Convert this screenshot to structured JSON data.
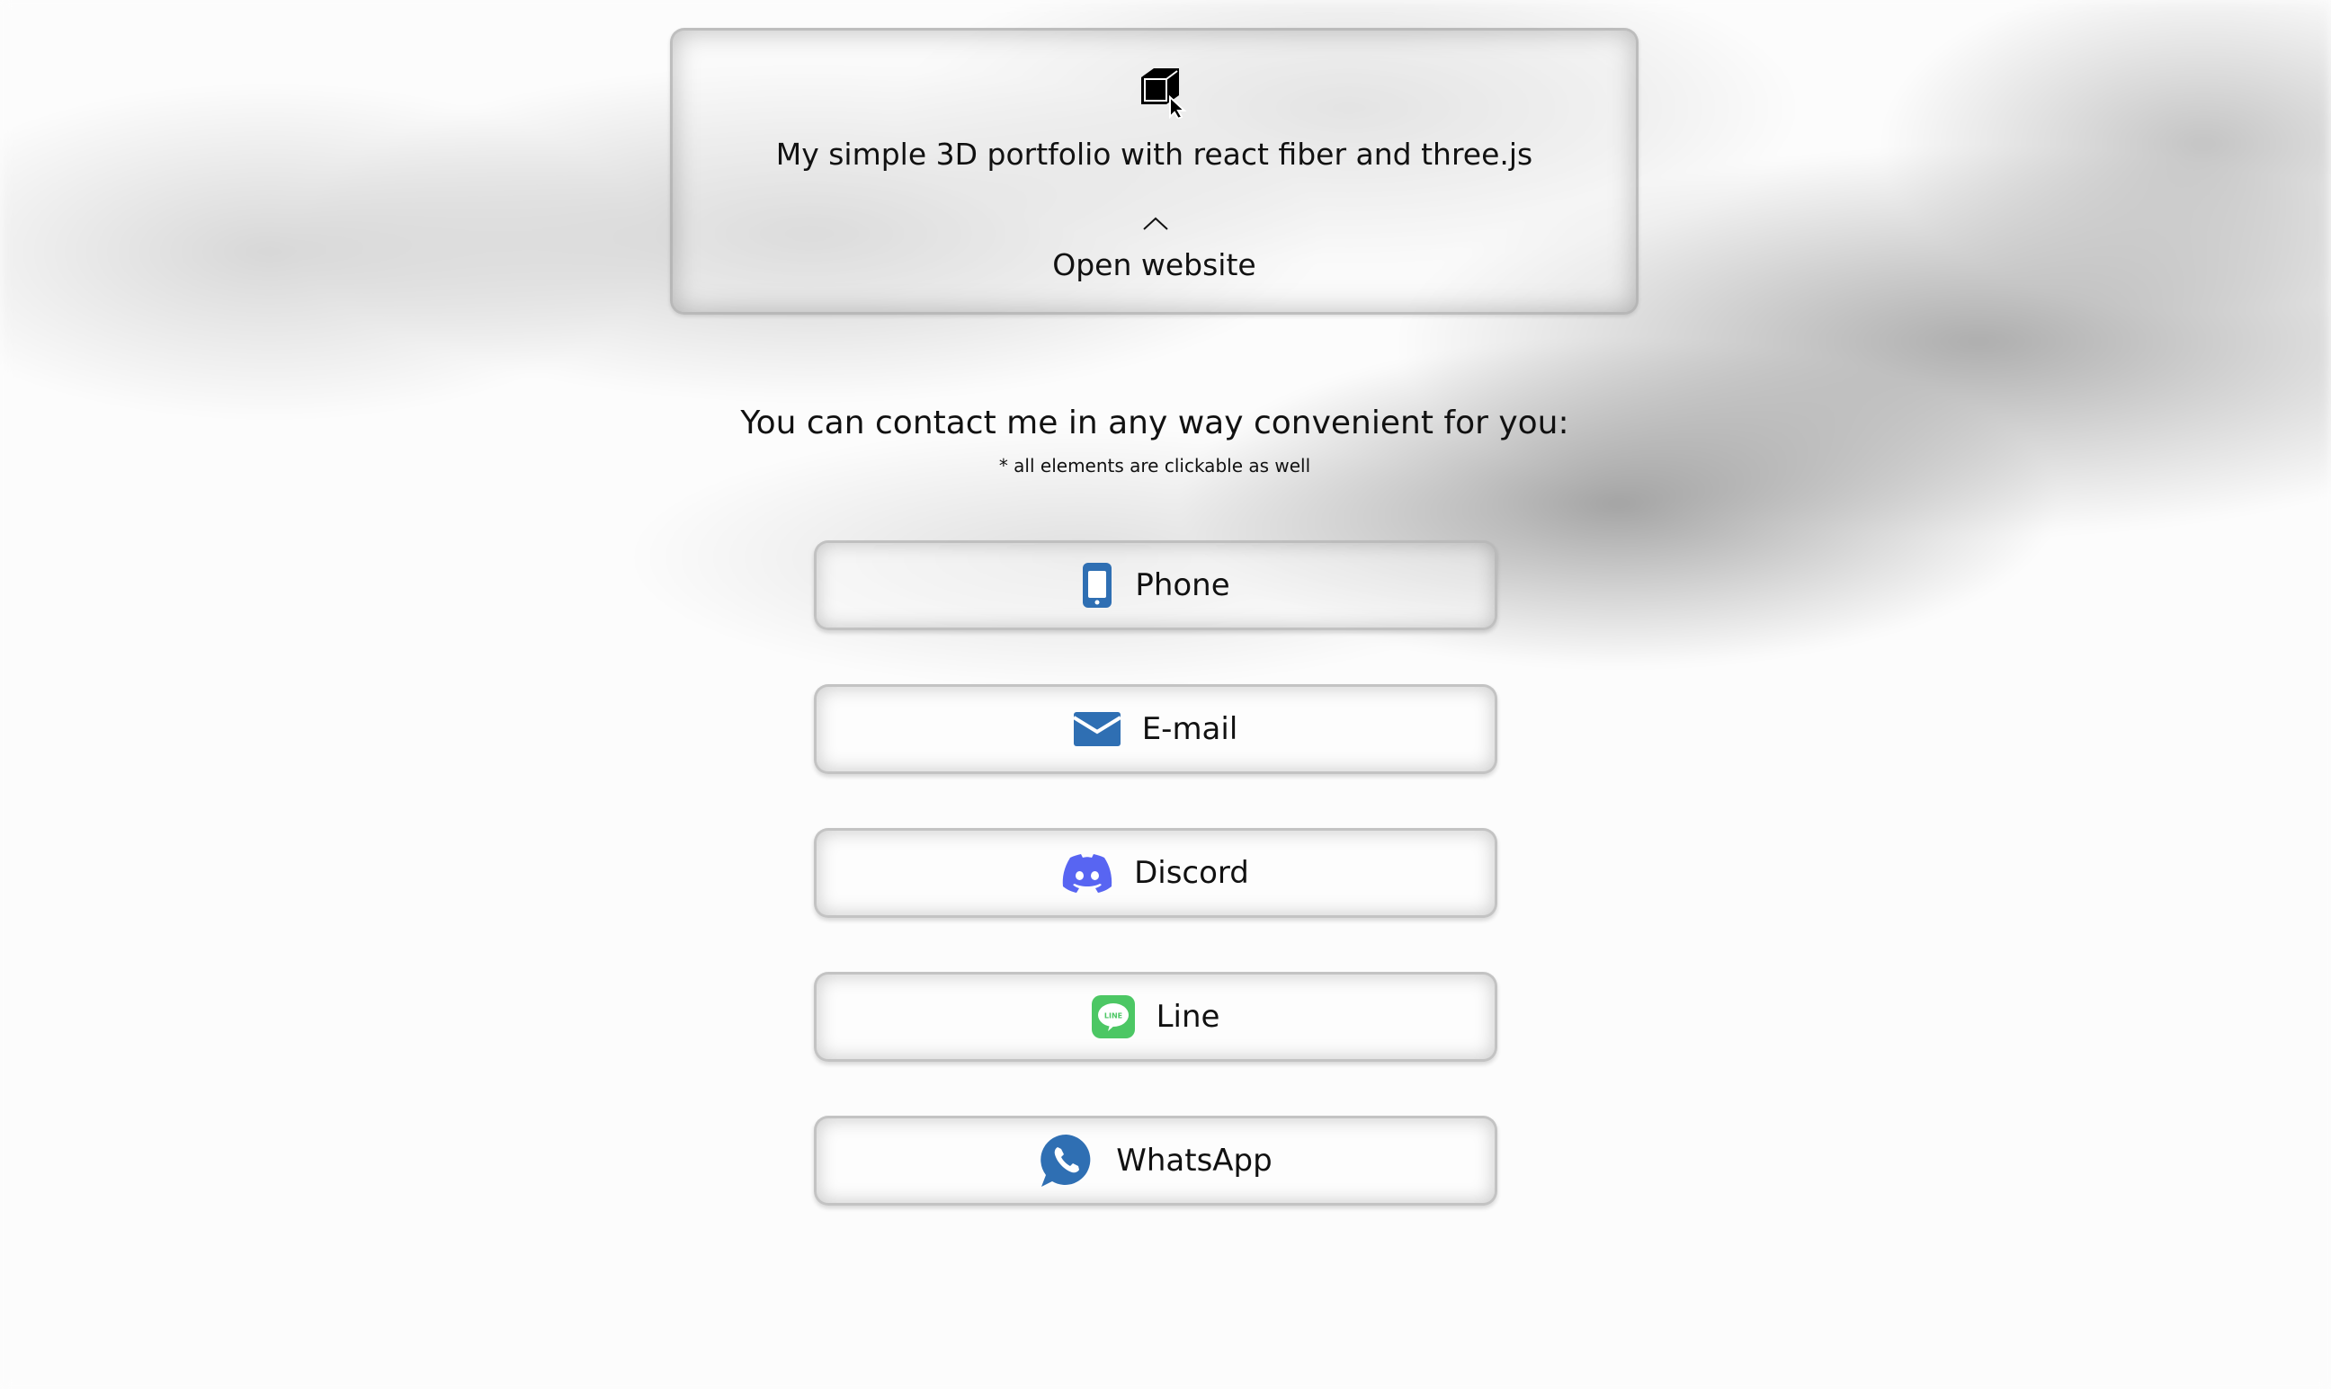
{
  "project_card": {
    "title": "My simple 3D portfolio with react fiber and three.js",
    "open_label": "Open website",
    "icon": "cube-cursor-icon"
  },
  "contact": {
    "heading": "You can contact me in any way convenient for you:",
    "note": "* all elements are clickable as well",
    "buttons": [
      {
        "label": "Phone",
        "icon": "phone-icon",
        "color": "#2f6fb3"
      },
      {
        "label": "E-mail",
        "icon": "envelope-icon",
        "color": "#2f6fb3"
      },
      {
        "label": "Discord",
        "icon": "discord-icon",
        "color": "#5865f2"
      },
      {
        "label": "Line",
        "icon": "line-icon",
        "color": "#4cc764"
      },
      {
        "label": "WhatsApp",
        "icon": "whatsapp-icon",
        "color": "#2f6fb3"
      }
    ]
  }
}
